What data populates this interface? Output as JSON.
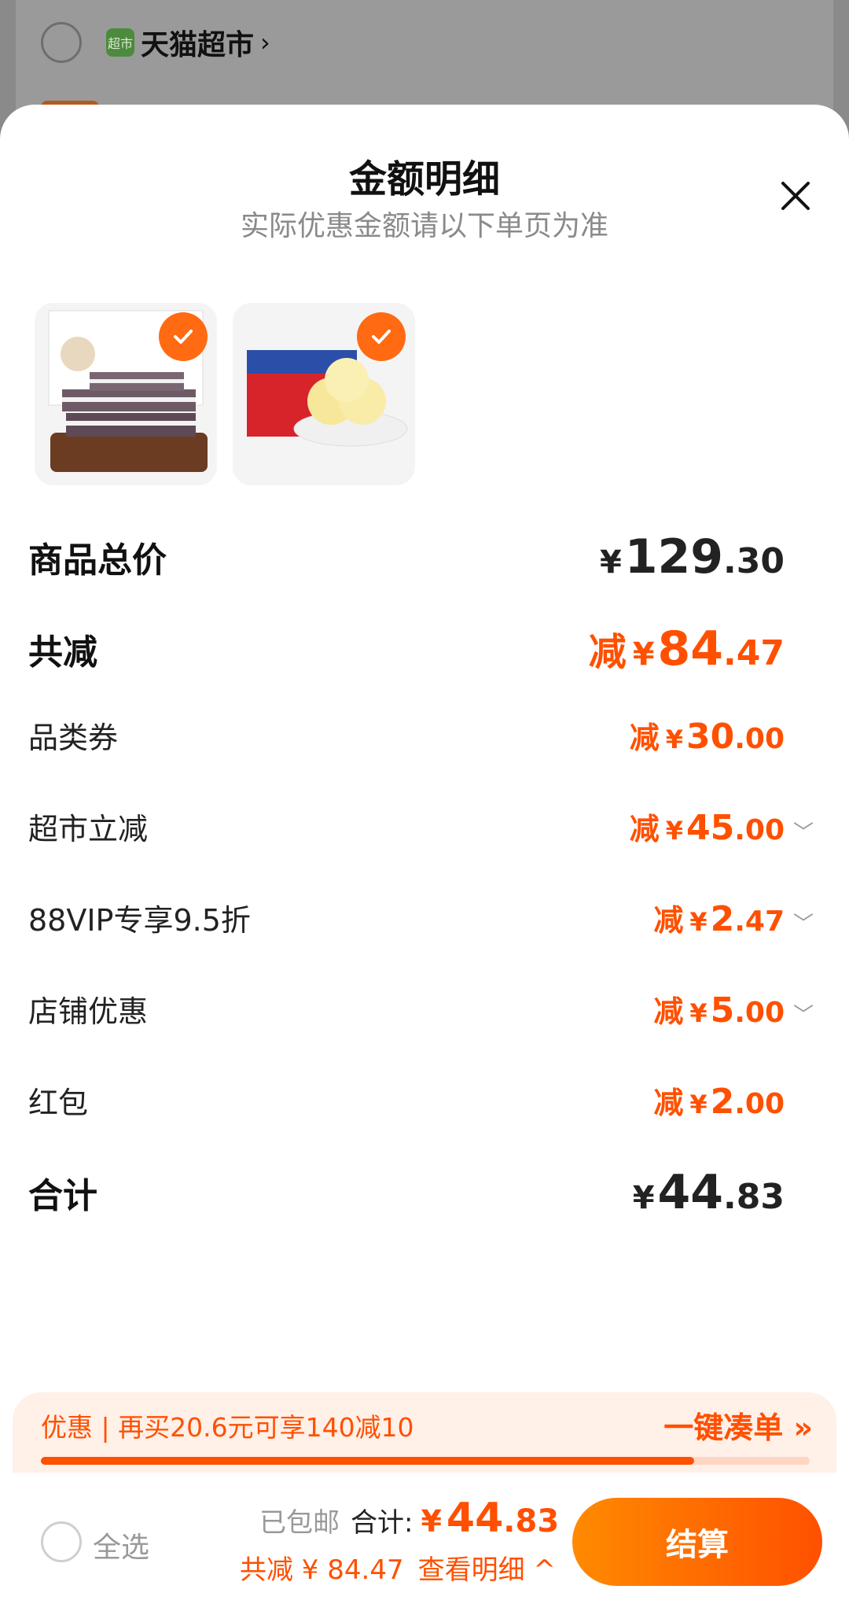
{
  "background": {
    "store_logo_text": "超市",
    "store_name": "天猫超市"
  },
  "sheet": {
    "title": "金额明细",
    "subtitle": "实际优惠金额请以下单页为准"
  },
  "items": [
    {
      "name": "product-bread-1",
      "selected": true
    },
    {
      "name": "product-bread-2",
      "selected": true
    }
  ],
  "summary": {
    "total_label": "商品总价",
    "total_yen": "¥",
    "total_int": "129",
    "total_dec": ".30",
    "reduce_label": "共减",
    "reduce_prefix": "减",
    "reduce_yen": "¥",
    "reduce_int": "84",
    "reduce_dec": ".47",
    "final_label": "合计",
    "final_yen": "¥",
    "final_int": "44",
    "final_dec": ".83"
  },
  "discounts": [
    {
      "label": "品类券",
      "prefix": "减",
      "yen": "¥",
      "int": "30",
      "dec": ".00",
      "expandable": false
    },
    {
      "label": "超市立减",
      "prefix": "减",
      "yen": "¥",
      "int": "45",
      "dec": ".00",
      "expandable": true
    },
    {
      "label": "88VIP专享9.5折",
      "prefix": "减",
      "yen": "¥",
      "int": "2",
      "dec": ".47",
      "expandable": true
    },
    {
      "label": "店铺优惠",
      "prefix": "减",
      "yen": "¥",
      "int": "5",
      "dec": ".00",
      "expandable": true
    },
    {
      "label": "红包",
      "prefix": "减",
      "yen": "¥",
      "int": "2",
      "dec": ".00",
      "expandable": false
    }
  ],
  "promo": {
    "text": "优惠 | 再买20.6元可享140减10",
    "link": "一键凑单 »",
    "progress": 0.85
  },
  "bottom": {
    "select_all": "全选",
    "shipping": "已包邮",
    "total_label": "合计:",
    "yen": "¥",
    "total_int": "44",
    "total_dec": ".83",
    "reduce_text": "共减 ¥ 84.47",
    "detail_link": "查看明细 ^",
    "checkout": "结算"
  },
  "colors": {
    "accent": "#ff5000",
    "accent_gradient_start": "#ff8a00"
  }
}
